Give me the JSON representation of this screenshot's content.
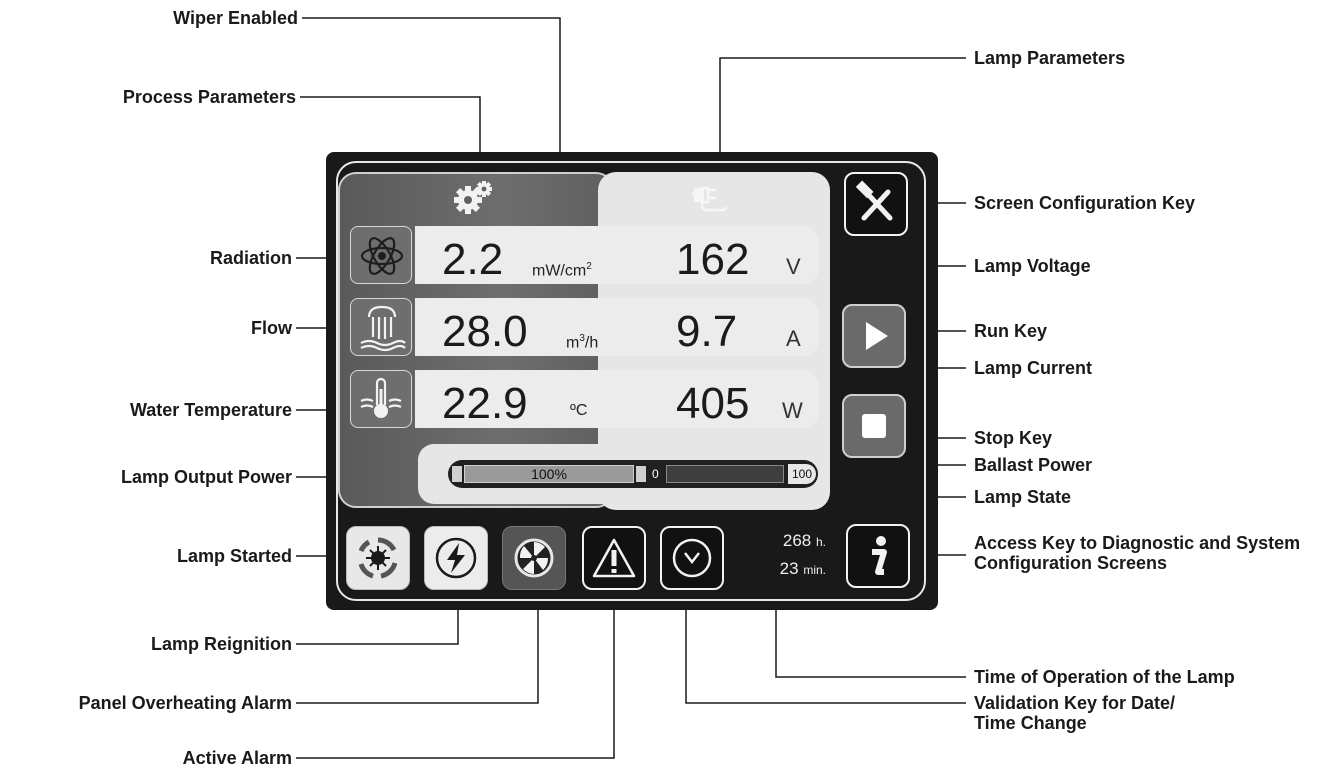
{
  "callouts": {
    "wiper_enabled": "Wiper Enabled",
    "process_parameters": "Process Parameters",
    "radiation": "Radiation",
    "flow": "Flow",
    "water_temperature": "Water Temperature",
    "lamp_output_power": "Lamp Output Power",
    "lamp_started": "Lamp Started",
    "lamp_reignition": "Lamp Reignition",
    "panel_overheating_alarm": "Panel Overheating Alarm",
    "active_alarm": "Active Alarm",
    "lamp_parameters": "Lamp Parameters",
    "screen_configuration_key": "Screen Configuration Key",
    "lamp_voltage": "Lamp Voltage",
    "run_key": "Run Key",
    "lamp_current": "Lamp Current",
    "stop_key": "Stop Key",
    "ballast_power": "Ballast Power",
    "lamp_state": "Lamp State",
    "access_key": "Access Key to Diagnostic and System Configuration Screens",
    "time_of_operation": "Time of Operation of the Lamp",
    "validation_key": "Validation Key for Date/ Time Change"
  },
  "process": {
    "radiation_value": "2.2",
    "radiation_unit": "mW/cm",
    "radiation_unit_sup": "2",
    "flow_value": "28.0",
    "flow_unit": "m",
    "flow_unit_sup": "3",
    "flow_unit_tail": "/h",
    "temperature_value": "22.9",
    "temperature_unit": "ºC"
  },
  "lamp": {
    "voltage_value": "162",
    "voltage_unit": "V",
    "current_value": "9.7",
    "current_unit": "A",
    "power_value": "405",
    "power_unit": "W"
  },
  "power_bar": {
    "lamp_output_percent_label": "100%",
    "lamp_output_fraction": 1.0,
    "ballast_min": "0",
    "ballast_max": "100"
  },
  "operation_time": {
    "hours": "268",
    "hours_unit": "h.",
    "minutes": "23",
    "minutes_unit": "min."
  },
  "icons": {
    "process_header": "gears-icon",
    "lamp_header": "plug-icon",
    "radiation": "atom-icon",
    "flow": "water-flow-icon",
    "temperature": "thermometer-icon",
    "screen_config": "hammer-wrench-icon",
    "run": "play-icon",
    "stop": "stop-icon",
    "info": "info-icon",
    "lamp_started": "sun-icon",
    "lamp_reignition": "lightning-icon",
    "panel_overheating": "fan-icon",
    "active_alarm": "warning-icon",
    "validation": "chevron-check-icon"
  },
  "colors": {
    "screen_background": "#191919",
    "panel_light": "#e6e6e6",
    "panel_dark": "#6a6a6a",
    "label_text": "#1a1a1a"
  }
}
